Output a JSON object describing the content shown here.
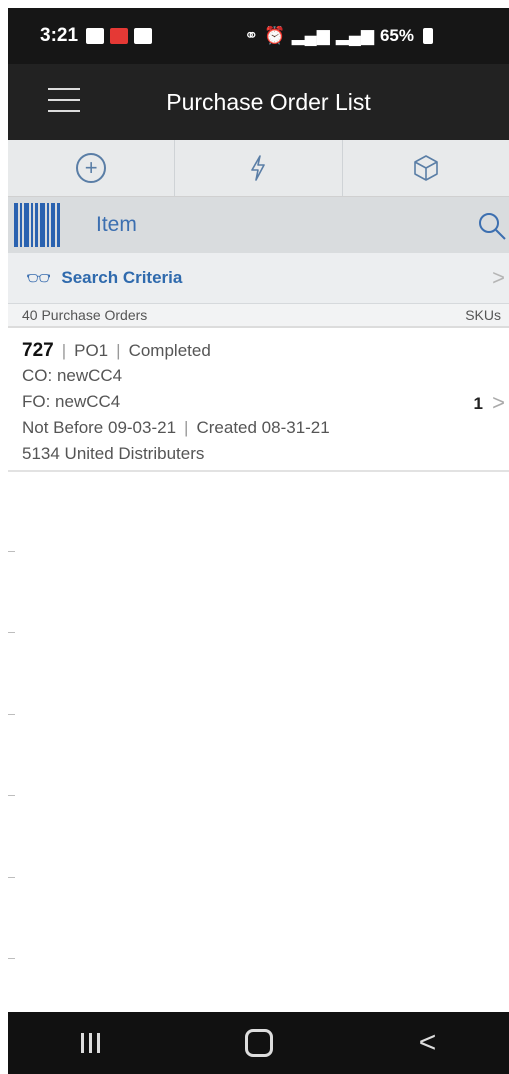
{
  "status_bar": {
    "time": "3:21",
    "battery": "65%",
    "icons": [
      "gallery-icon",
      "calendar-icon",
      "home-icon",
      "link-icon",
      "alarm-icon",
      "signal-icon",
      "volte-icon",
      "wifi-icon",
      "signal-icon",
      "battery-icon"
    ]
  },
  "app_bar": {
    "title": "Purchase Order List"
  },
  "actions": [
    {
      "icon": "plus-circle-icon"
    },
    {
      "icon": "lightning-icon"
    },
    {
      "icon": "cube-icon"
    }
  ],
  "item_scan": {
    "label": "Item"
  },
  "search_criteria": {
    "label": "Search Criteria"
  },
  "list": {
    "count_label": "40 Purchase Orders",
    "skus_header": "SKUs",
    "orders": [
      {
        "number": "727",
        "po": "PO1",
        "status": "Completed",
        "co": "CO: newCC4",
        "fo": "FO: newCC4",
        "not_before": "Not Before 09-03-21",
        "created": "Created 08-31-21",
        "vendor": "5134 United Distributers",
        "skus": "1"
      }
    ]
  },
  "colors": {
    "accent": "#3c6fb0",
    "app_bar": "#222222",
    "status_bar": "#161616"
  }
}
